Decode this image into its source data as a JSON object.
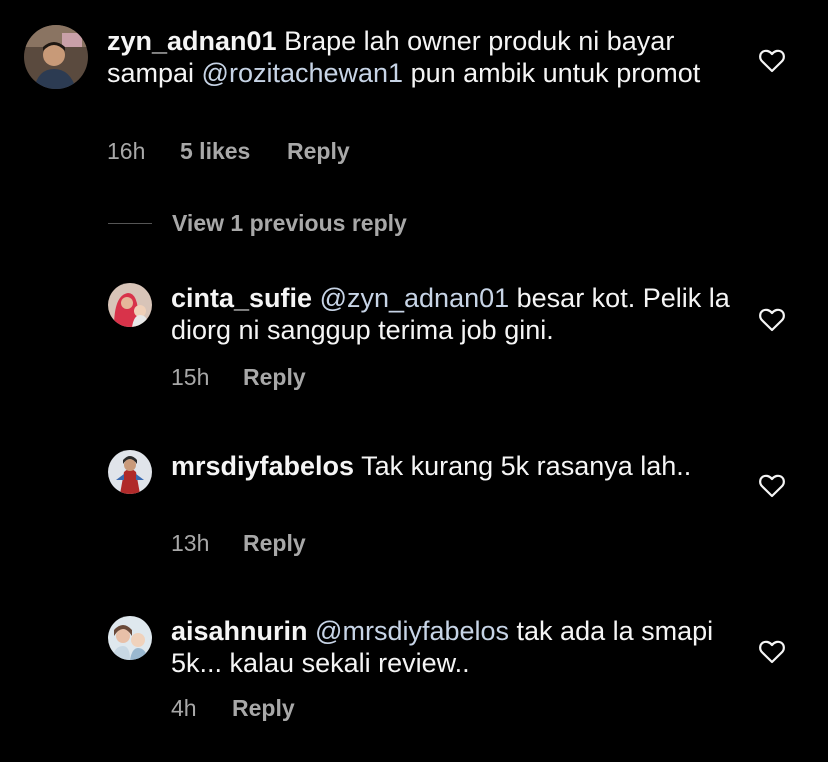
{
  "comments": [
    {
      "username": "zyn_adnan01",
      "text_before": " Brape lah owner produk ni bayar sampai ",
      "mention": "@rozitachewan1",
      "text_after": " pun ambik untuk promot",
      "time": "16h",
      "likes": "5 likes",
      "reply_label": "Reply"
    }
  ],
  "view_previous": "View 1 previous reply",
  "replies": [
    {
      "username": "cinta_sufie",
      "mention": "@zyn_adnan01",
      "text": " besar kot. Pelik la diorg ni sanggup terima job gini.",
      "time": "15h",
      "reply_label": "Reply"
    },
    {
      "username": "mrsdiyfabelos",
      "mention": "",
      "text": " Tak kurang 5k rasanya lah..",
      "time": "13h",
      "reply_label": "Reply"
    },
    {
      "username": "aisahnurin",
      "mention": "@mrsdiyfabelos",
      "text": " tak ada la smapi 5k... kalau sekali review..",
      "time": "4h",
      "reply_label": "Reply"
    }
  ],
  "icons": {
    "like": "heart-outline-icon"
  },
  "colors": {
    "background": "#000000",
    "primary_text": "#f5f5f5",
    "secondary_text": "#a8a8a8",
    "mention": "#c7d4e6"
  }
}
